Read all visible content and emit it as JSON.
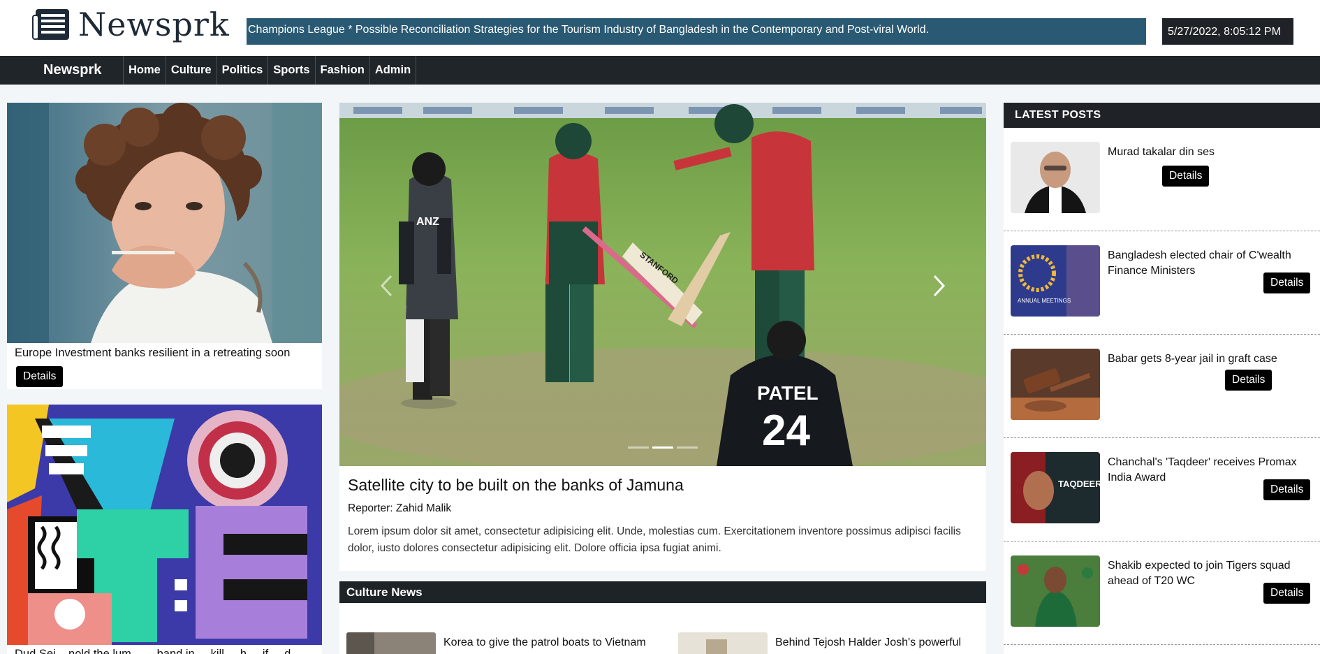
{
  "header": {
    "logo_text": "Newsprk",
    "ticker": "Champions League * Possible Reconciliation Strategies for the Tourism Industry of Bangladesh in the Contemporary and Post-viral World.",
    "datetime": "5/27/2022, 8:05:12 PM"
  },
  "nav": {
    "brand": "Newsprk",
    "links": [
      "Home",
      "Culture",
      "Politics",
      "Sports",
      "Fashion",
      "Admin"
    ]
  },
  "left": {
    "cards": [
      {
        "title": "Europe Investment banks resilient in a retreating soon",
        "button": "Details"
      },
      {
        "title": "Dud Sei... nold the lum... ... band in ... kill ... h ... if ... d..."
      }
    ]
  },
  "hero": {
    "title": "Satellite city to be built on the banks of Jamuna",
    "reporter": "Reporter: Zahid Malik",
    "excerpt": "Lorem ipsum dolor sit amet, consectetur adipisicing elit. Unde, molestias cum. Exercitationem inventore possimus adipisci facilis dolor, iusto dolores consectetur adipisicing elit. Dolore officia ipsa fugiat animi.",
    "slides": 3,
    "active_slide": 2
  },
  "culture": {
    "heading": "Culture News",
    "items": [
      {
        "title": "Korea to give the patrol boats to Vietnam"
      },
      {
        "title": "Behind Tejosh Halder Josh's powerful"
      }
    ]
  },
  "latest": {
    "heading": "LATEST POSTS",
    "posts": [
      {
        "title": "Murad takalar din ses",
        "button": "Details"
      },
      {
        "title": "Bangladesh elected chair of C'wealth Finance Ministers",
        "button": "Details"
      },
      {
        "title": "Babar gets 8-year jail in graft case",
        "button": "Details"
      },
      {
        "title": "Chanchal's 'Taqdeer' receives Promax India Award",
        "button": "Details"
      },
      {
        "title": "Shakib expected to join Tigers squad ahead of T20 WC",
        "button": "Details"
      }
    ]
  },
  "images": {
    "taqdeer_text": "TAQDEER",
    "jersey_name": "PATEL",
    "jersey_number": "24",
    "shirt_text": "ANZ",
    "bat_text": "STANFORD",
    "annual_text": "ANNUAL MEETINGS"
  }
}
